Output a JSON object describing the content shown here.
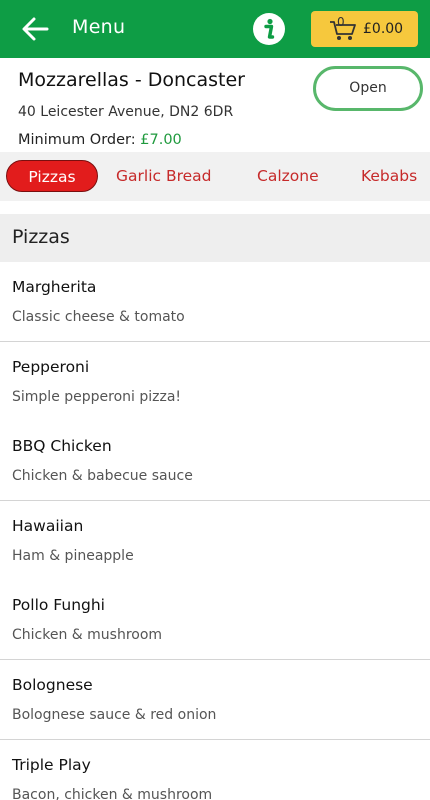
{
  "header": {
    "title": "Menu",
    "back_icon": "arrow-left-icon",
    "info_icon": "info-icon",
    "cart": {
      "icon": "cart-icon",
      "count": "0",
      "total": "£0.00"
    },
    "colors": {
      "bar": "#0e9d45",
      "cart": "#f6c83d"
    }
  },
  "shop": {
    "name": "Mozzarellas - Doncaster",
    "address": "40 Leicester Avenue, DN2 6DR",
    "min_order_label": "Minimum Order:",
    "min_order_value": "£7.00",
    "status": "Open"
  },
  "categories": [
    "Pizzas",
    "Garlic Bread",
    "Calzone",
    "Kebabs"
  ],
  "active_category": "Pizzas",
  "section": {
    "title": "Pizzas"
  },
  "items": [
    {
      "name": "Margherita",
      "desc": "Classic cheese & tomato"
    },
    {
      "name": "Pepperoni",
      "desc": "Simple pepperoni pizza!"
    },
    {
      "name": "BBQ Chicken",
      "desc": "Chicken & babecue sauce"
    },
    {
      "name": "Hawaiian",
      "desc": "Ham & pineapple"
    },
    {
      "name": "Pollo Funghi",
      "desc": "Chicken & mushroom"
    },
    {
      "name": "Bolognese",
      "desc": "Bolognese sauce & red onion"
    },
    {
      "name": "Triple Play",
      "desc": "Bacon, chicken & mushroom"
    }
  ]
}
